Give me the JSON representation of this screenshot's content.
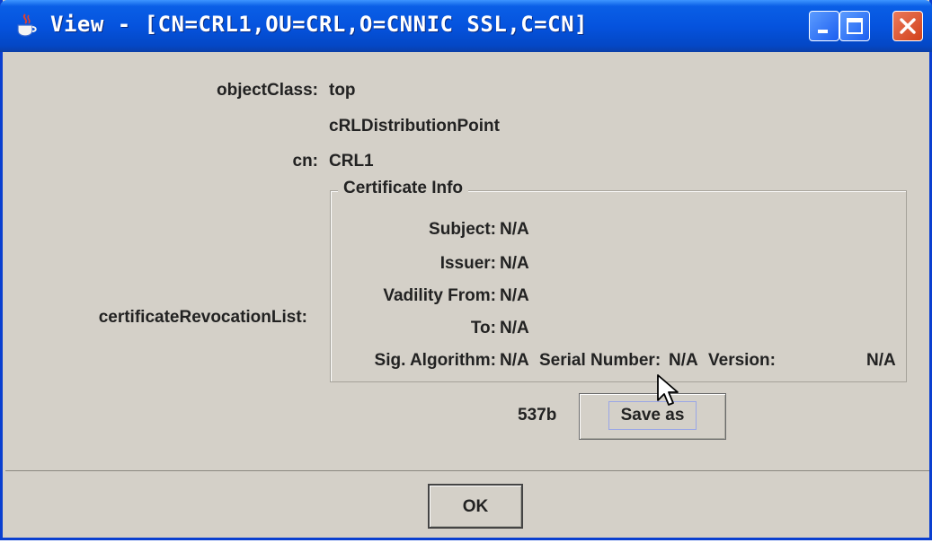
{
  "window": {
    "title": "View - [CN=CRL1,OU=CRL,O=CNNIC SSL,C=CN]"
  },
  "attributes": {
    "objectclass_label": "objectClass:",
    "objectclass_values": [
      "top",
      "cRLDistributionPoint"
    ],
    "cn_label": "cn:",
    "cn_value": "CRL1",
    "crl_label": "certificateRevocationList:"
  },
  "certificate_info": {
    "legend": "Certificate Info",
    "subject_label": "Subject:",
    "subject_value": "N/A",
    "issuer_label": "Issuer:",
    "issuer_value": "N/A",
    "valid_from_label": "Vadility From:",
    "valid_from_value": "N/A",
    "to_label": "To:",
    "to_value": "N/A",
    "sig_label": "Sig. Algorithm:",
    "sig_value": "N/A",
    "serial_label": "Serial Number:",
    "serial_value": "N/A",
    "version_label": "Version:",
    "version_value": "N/A"
  },
  "crl": {
    "size": "537b",
    "save_label": "Save as"
  },
  "footer": {
    "ok_label": "OK"
  },
  "icons": {
    "title": "java-cup-icon",
    "minimize": "minimize-icon",
    "maximize": "maximize-icon",
    "close": "close-icon",
    "cursor": "mouse-pointer-icon"
  },
  "colors": {
    "titlebar": "#0553de",
    "window_bg": "#d4d0c8",
    "close_button": "#d2401a"
  }
}
